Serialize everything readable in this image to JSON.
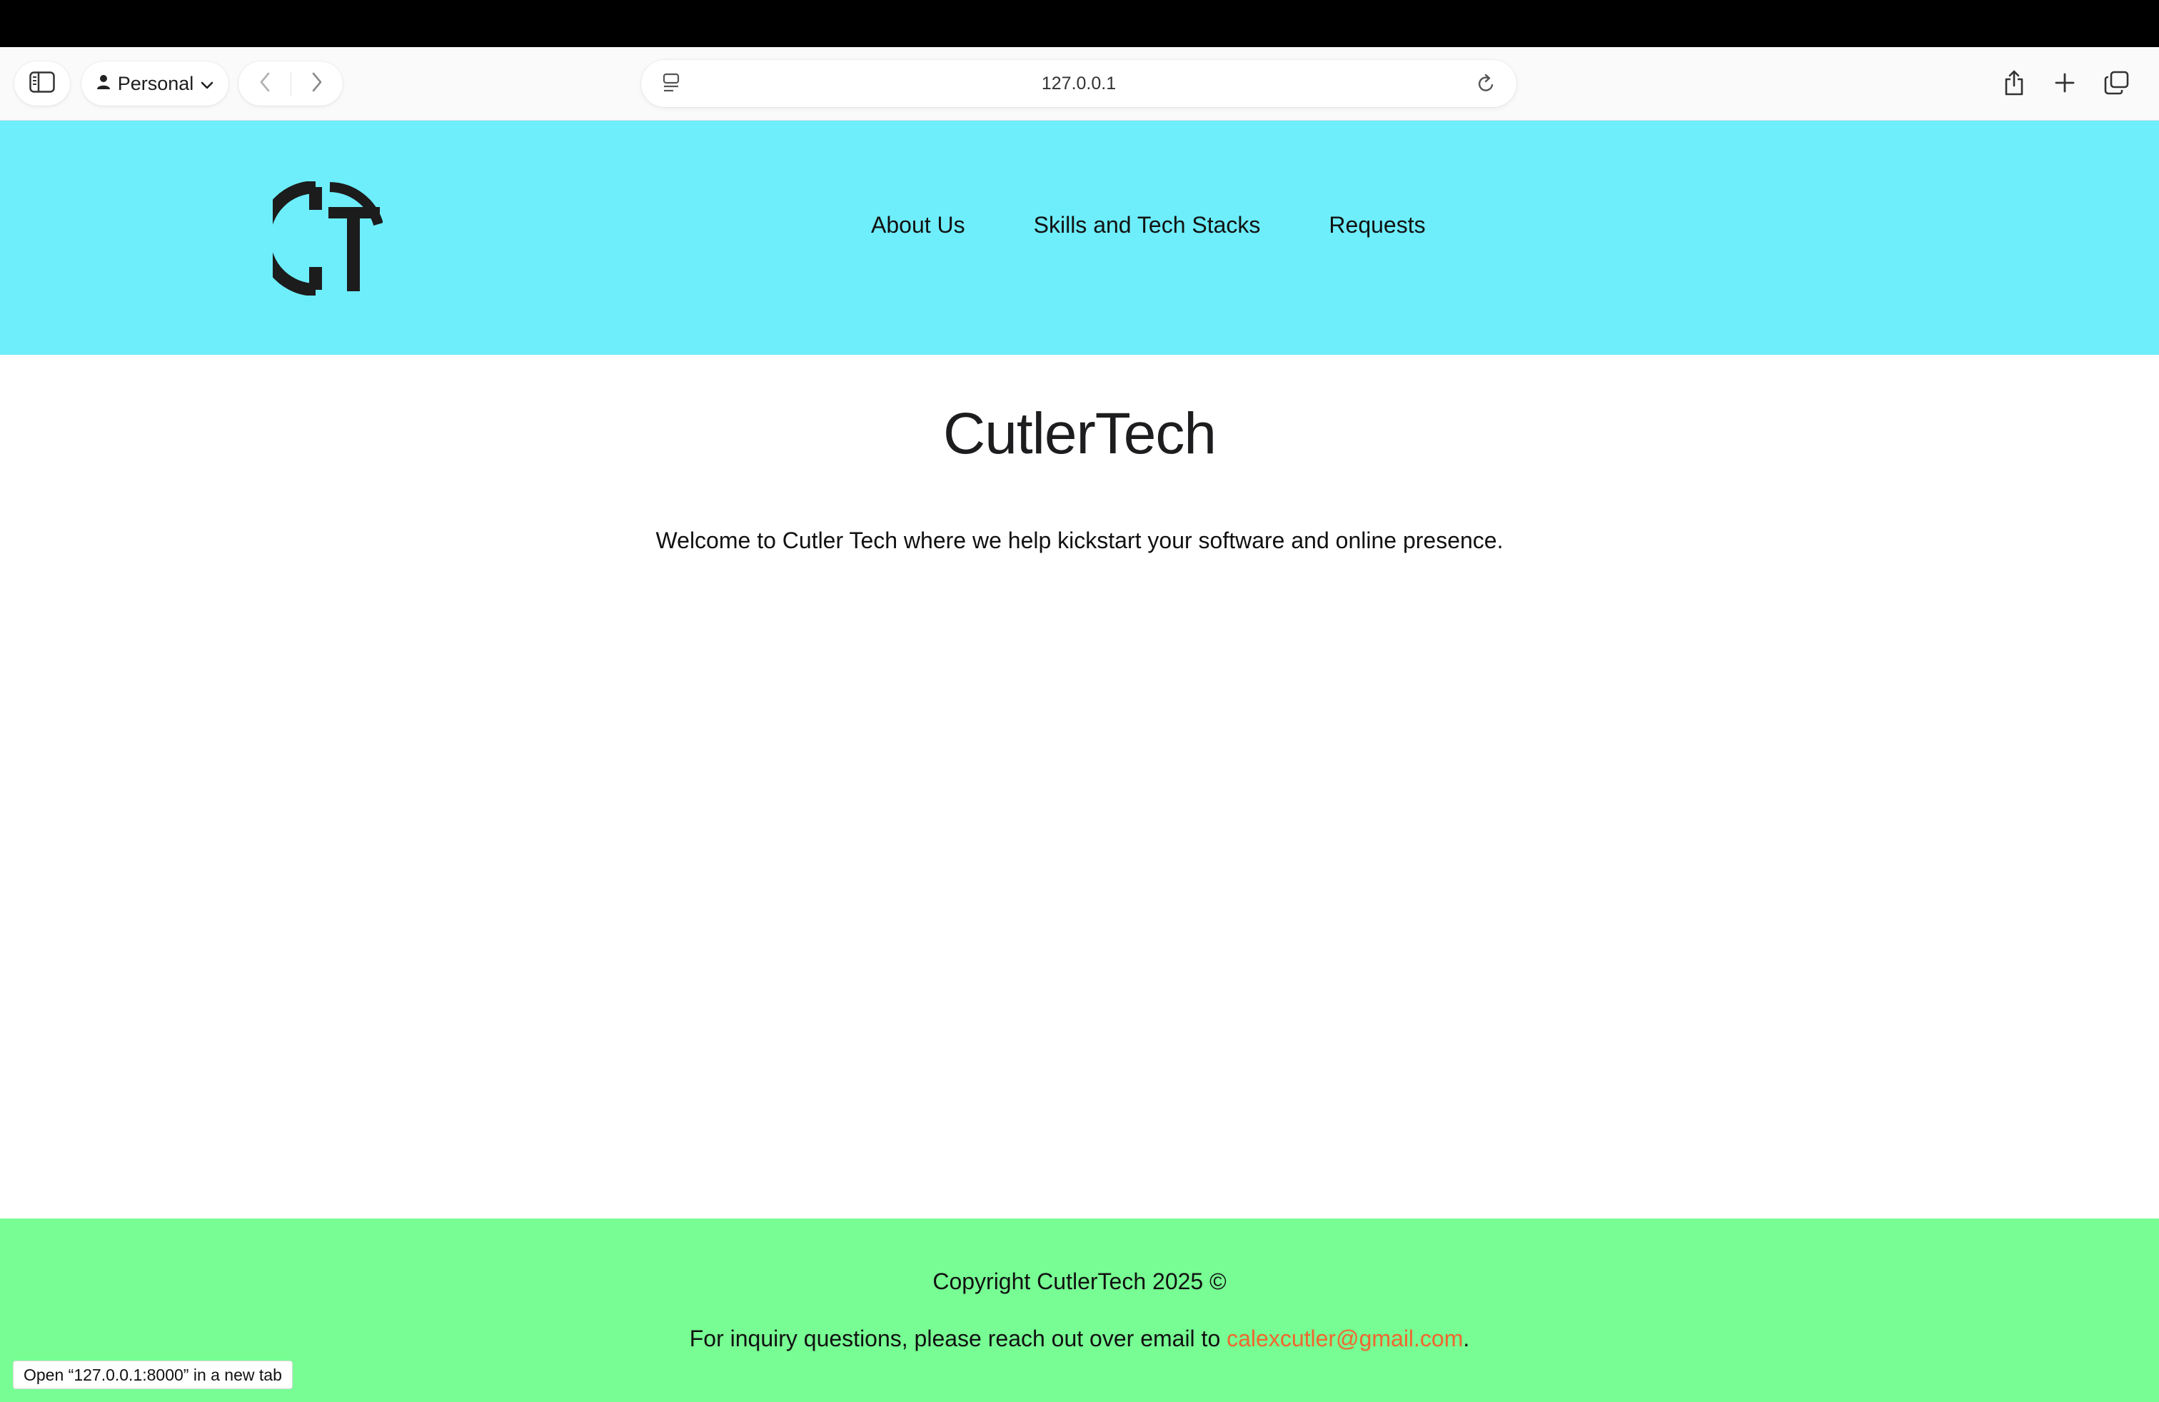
{
  "browser": {
    "profile_label": "Personal",
    "url": "127.0.0.1",
    "status_link": "Open “127.0.0.1:8000” in a new tab"
  },
  "site": {
    "nav": {
      "about": "About Us",
      "skills": "Skills and Tech Stacks",
      "requests": "Requests"
    },
    "title": "CutlerTech",
    "welcome": "Welcome to Cutler Tech where we help kickstart your software and online presence.",
    "footer": {
      "copyright": "Copyright CutlerTech 2025 ©",
      "inquiry_prefix": "For inquiry questions, please reach out over email to ",
      "email": "calexcutler@gmail.com",
      "inquiry_suffix": "."
    }
  },
  "colors": {
    "header_bg": "#6eedfb",
    "footer_bg": "#77fd93",
    "email_link": "#f0662f"
  },
  "icons": [
    "sidebar-icon",
    "person-icon",
    "chevron-down-icon",
    "back-icon",
    "forward-icon",
    "reader-icon",
    "reload-icon",
    "share-icon",
    "new-tab-icon",
    "tab-overview-icon",
    "ct-logo"
  ]
}
